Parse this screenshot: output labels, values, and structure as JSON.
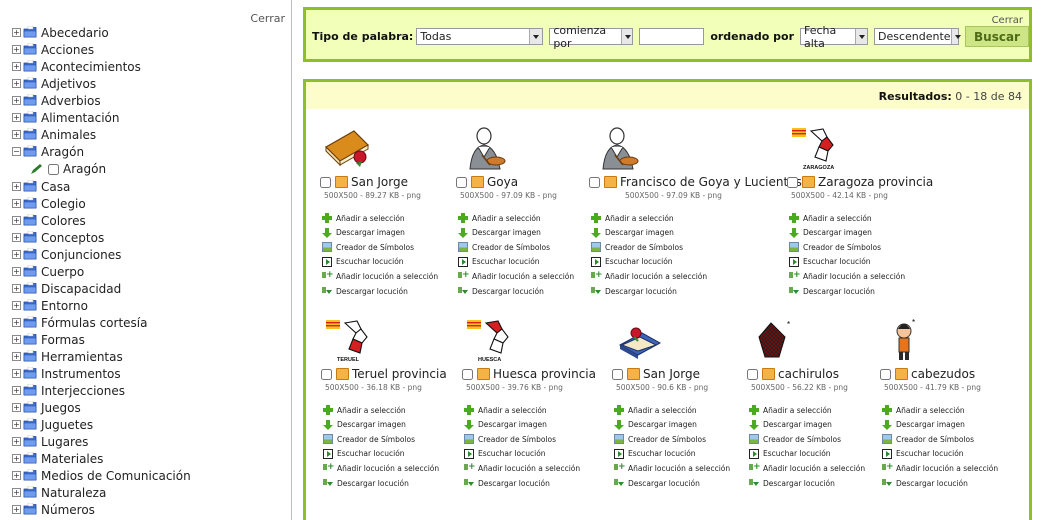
{
  "sidebar": {
    "close_label": "Cerrar",
    "items": [
      {
        "label": "Abecedario",
        "expander": "⊞"
      },
      {
        "label": "Acciones",
        "expander": "⊞"
      },
      {
        "label": "Acontecimientos",
        "expander": "⊞"
      },
      {
        "label": "Adjetivos",
        "expander": "⊞"
      },
      {
        "label": "Adverbios",
        "expander": "⊞"
      },
      {
        "label": "Alimentación",
        "expander": "⊞"
      },
      {
        "label": "Animales",
        "expander": "⊞"
      },
      {
        "label": "Aragón",
        "expander": "⊟"
      },
      {
        "label": "Aragón",
        "expander": ""
      },
      {
        "label": "Casa",
        "expander": "⊞"
      },
      {
        "label": "Colegio",
        "expander": "⊞"
      },
      {
        "label": "Colores",
        "expander": "⊞"
      },
      {
        "label": "Conceptos",
        "expander": "⊞"
      },
      {
        "label": "Conjunciones",
        "expander": "⊞"
      },
      {
        "label": "Cuerpo",
        "expander": "⊞"
      },
      {
        "label": "Discapacidad",
        "expander": "⊞"
      },
      {
        "label": "Entorno",
        "expander": "⊞"
      },
      {
        "label": "Fórmulas cortesía",
        "expander": "⊞"
      },
      {
        "label": "Formas",
        "expander": "⊞"
      },
      {
        "label": "Herramientas",
        "expander": "⊞"
      },
      {
        "label": "Instrumentos",
        "expander": "⊞"
      },
      {
        "label": "Interjecciones",
        "expander": "⊞"
      },
      {
        "label": "Juegos",
        "expander": "⊞"
      },
      {
        "label": "Juguetes",
        "expander": "⊞"
      },
      {
        "label": "Lugares",
        "expander": "⊞"
      },
      {
        "label": "Materiales",
        "expander": "⊞"
      },
      {
        "label": "Medios de Comunicación",
        "expander": "⊞"
      },
      {
        "label": "Naturaleza",
        "expander": "⊞"
      },
      {
        "label": "Números",
        "expander": "⊞"
      }
    ]
  },
  "search": {
    "close_label": "Cerrar",
    "word_type_label": "Tipo de palabra:",
    "word_type_value": "Todas",
    "match_value": "comienza por",
    "ordered_label": "ordenado por",
    "order_value": "Fecha alta",
    "direction_value": "Descendente",
    "search_button": "Buscar"
  },
  "results": {
    "label": "Resultados:",
    "range": "0 - 18 de 84",
    "actions": {
      "add": "Añadir a selección",
      "download": "Descargar imagen",
      "creator": "Creador de Símbolos",
      "listen": "Escuchar locución",
      "add_sound": "Añadir locución a selección",
      "download_sound": "Descargar locución"
    },
    "items": [
      {
        "title": "San Jorge",
        "meta": "500X500 - 89.27 KB - png",
        "icon": "book-rose-icon"
      },
      {
        "title": "Goya",
        "meta": "500X500 - 97.09 KB - png",
        "icon": "goya-portrait-icon"
      },
      {
        "title": "Francisco de Goya y Lucientes",
        "meta": "500X500 - 97.09 KB - png",
        "icon": "goya-portrait-icon"
      },
      {
        "title": "Zaragoza provincia",
        "meta": "500X500 - 42.14 KB - png",
        "icon": "map-zaragoza-icon",
        "caption": "ZARAGOZA"
      },
      {
        "title": "Teruel provincia",
        "meta": "500X500 - 36.18 KB - png",
        "icon": "map-teruel-icon",
        "caption": "TERUEL"
      },
      {
        "title": "Huesca provincia",
        "meta": "500X500 - 39.76 KB - png",
        "icon": "map-huesca-icon",
        "caption": "HUESCA"
      },
      {
        "title": "San Jorge",
        "meta": "500X500 - 90.6 KB - png",
        "icon": "book-stand-rose-icon"
      },
      {
        "title": "cachirulos",
        "meta": "500X500 - 56.22 KB - png",
        "icon": "cachirulo-scarf-icon"
      },
      {
        "title": "cabezudos",
        "meta": "500X500 - 41.79 KB - png",
        "icon": "cabezudo-figure-icon"
      }
    ]
  },
  "colors": {
    "panel_border": "#90bd2a",
    "search_bg": "#f1ffb9",
    "results_bar_bg": "#fcfdca",
    "button_bg": "#cde584"
  }
}
